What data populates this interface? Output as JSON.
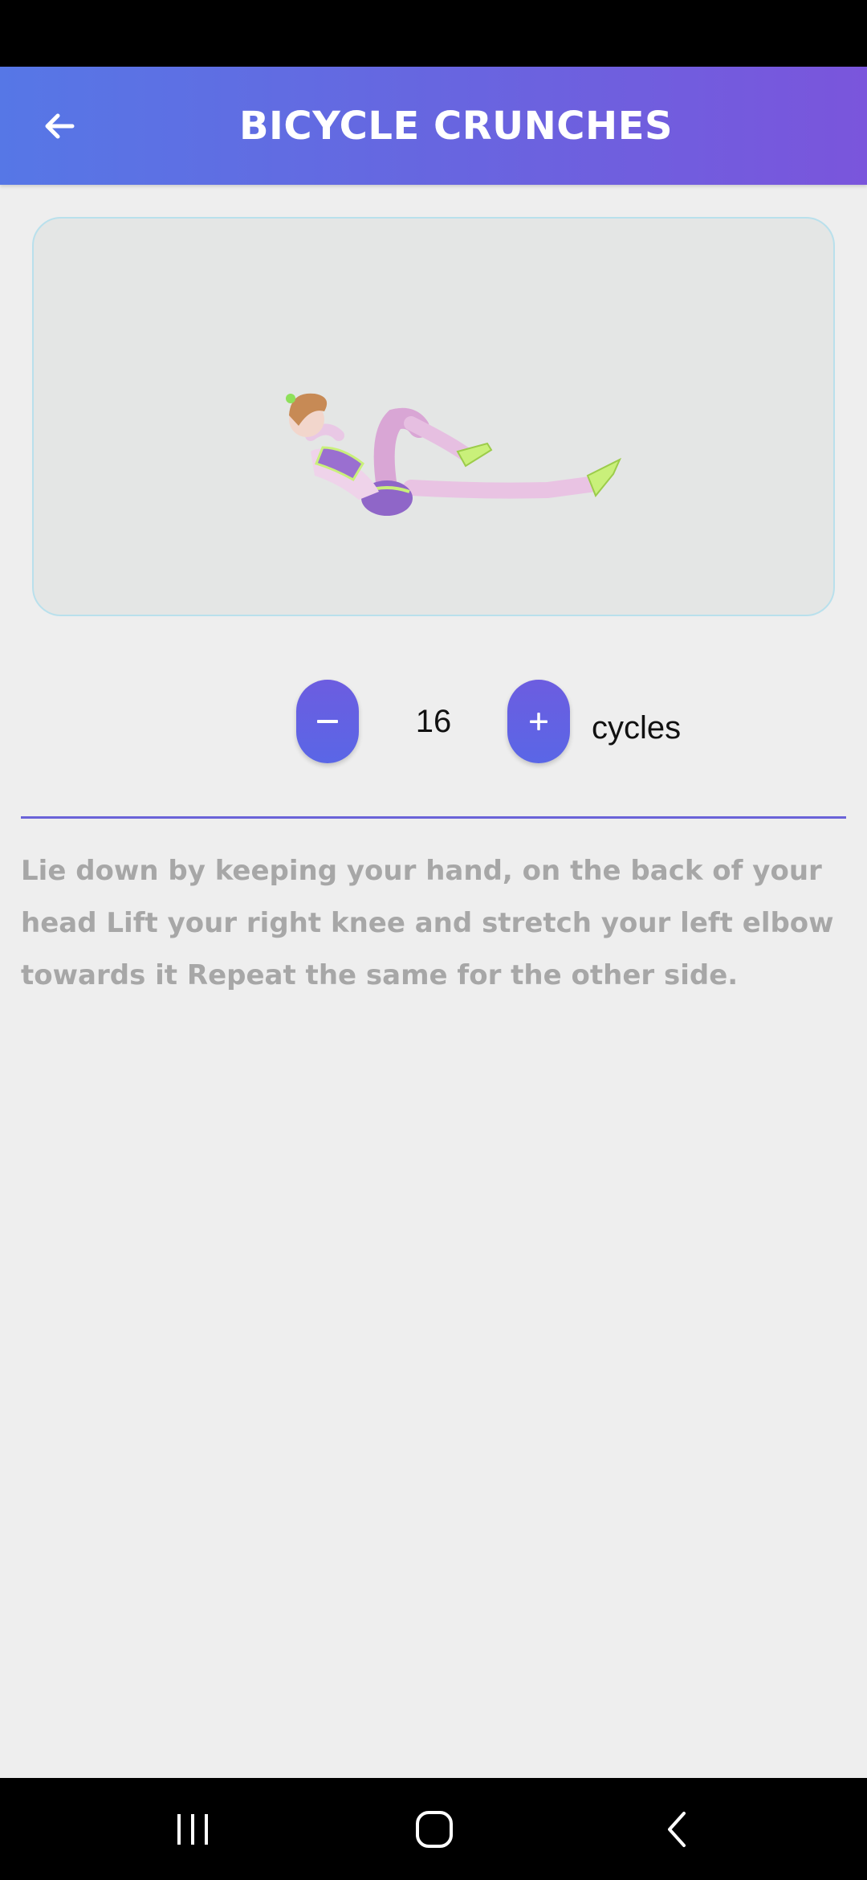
{
  "header": {
    "title": "BICYCLE CRUNCHES",
    "back_icon": "arrow-left-icon"
  },
  "exercise": {
    "image_alt": "Woman performing bicycle crunches",
    "count": "16",
    "unit": "cycles",
    "minus_icon": "minus-icon",
    "plus_icon": "plus-icon",
    "plus_label": "+",
    "description": "Lie down by keeping your hand, on the back of your head Lift your right knee and stretch your left elbow towards it Repeat the same for the other side."
  },
  "navigation": {
    "recents_icon": "recents-icon",
    "home_icon": "home-icon",
    "back_icon": "back-chevron-icon"
  },
  "colors": {
    "header_gradient_start": "#5677e6",
    "header_gradient_end": "#7a55dc",
    "accent": "#6a63d8",
    "background": "#eeeeee",
    "description_text": "#a7a7a7"
  }
}
